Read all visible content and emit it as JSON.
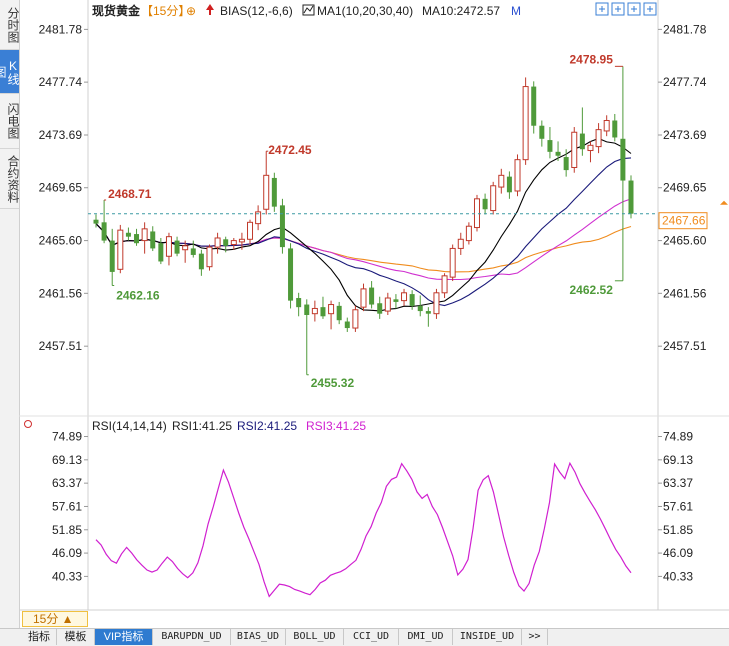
{
  "side_tabs": [
    "分时图",
    "K线图",
    "闪电图",
    "合约资料"
  ],
  "active_side_tab": 1,
  "header": {
    "symbol": "现货黄金",
    "period_tag": "【15分】",
    "bias_label": "BIAS(12,-6,6)",
    "ma_label": "MA1(10,20,30,40)",
    "ma10_value": "MA10:2472.57",
    "m_label": "M"
  },
  "rsi_header": {
    "title": "RSI(14,14,14)",
    "rsi1": "RSI1:41.25",
    "rsi2": "RSI2:41.25",
    "rsi3": "RSI3:41.25"
  },
  "period_selector": "15分 ▲",
  "bottom_tabs": [
    "指标",
    "模板",
    "VIP指标",
    "BARUPDN_UD",
    "BIAS_UD",
    "BOLL_UD",
    "CCI_UD",
    "DMI_UD",
    "INSIDE_UD",
    ">>"
  ],
  "active_bottom_tab": 2,
  "colors": {
    "up": "#c0392b",
    "down": "#4f9a3a",
    "ma_black": "#000000",
    "ma_magenta": "#d030d0",
    "ma_orange": "#f08c1e",
    "ma_navy": "#1a1a7a",
    "rsi_line": "#d020d0",
    "current_price": "#f08c1e"
  },
  "chart_data": [
    {
      "type": "candlestick",
      "title": "现货黄金 15分",
      "y_ticks": [
        2481.78,
        2477.74,
        2473.69,
        2469.65,
        2465.6,
        2461.56,
        2457.51
      ],
      "y_tick_labels": [
        "2481.78",
        "2477.74",
        "2473.69",
        "2469.65",
        "2465.60",
        "2461.56",
        "2457.51"
      ],
      "ylim": [
        2454.0,
        2482.5
      ],
      "current_price": 2467.66,
      "current_price_label": "2467.66",
      "annotations": [
        {
          "label": "2468.71",
          "candle": 1,
          "value": 2468.71
        },
        {
          "label": "2462.16",
          "candle": 2,
          "value": 2462.16
        },
        {
          "label": "2472.45",
          "candle": 21,
          "value": 2472.45
        },
        {
          "label": "2455.32",
          "candle": 26,
          "value": 2455.32
        },
        {
          "label": "2478.95",
          "candle": 65,
          "value": 2478.95
        },
        {
          "label": "2462.52",
          "candle": 65,
          "value": 2462.52
        }
      ],
      "candles": [
        {
          "o": 2467.2,
          "h": 2467.6,
          "l": 2466.6,
          "c": 2466.9
        },
        {
          "o": 2467.0,
          "h": 2468.71,
          "l": 2465.4,
          "c": 2465.6
        },
        {
          "o": 2465.6,
          "h": 2466.5,
          "l": 2462.16,
          "c": 2463.2
        },
        {
          "o": 2463.4,
          "h": 2466.8,
          "l": 2463.1,
          "c": 2466.4
        },
        {
          "o": 2466.2,
          "h": 2466.6,
          "l": 2465.6,
          "c": 2465.9
        },
        {
          "o": 2466.1,
          "h": 2466.5,
          "l": 2465.2,
          "c": 2465.4
        },
        {
          "o": 2465.6,
          "h": 2467.0,
          "l": 2464.6,
          "c": 2466.5
        },
        {
          "o": 2466.3,
          "h": 2466.7,
          "l": 2464.8,
          "c": 2465.0
        },
        {
          "o": 2465.4,
          "h": 2465.8,
          "l": 2463.8,
          "c": 2464.0
        },
        {
          "o": 2464.4,
          "h": 2466.2,
          "l": 2463.7,
          "c": 2465.9
        },
        {
          "o": 2465.6,
          "h": 2465.9,
          "l": 2464.4,
          "c": 2464.6
        },
        {
          "o": 2464.9,
          "h": 2465.6,
          "l": 2463.9,
          "c": 2465.2
        },
        {
          "o": 2465.0,
          "h": 2465.6,
          "l": 2464.3,
          "c": 2464.5
        },
        {
          "o": 2464.6,
          "h": 2464.9,
          "l": 2462.9,
          "c": 2463.4
        },
        {
          "o": 2463.6,
          "h": 2465.3,
          "l": 2463.3,
          "c": 2465.1
        },
        {
          "o": 2465.1,
          "h": 2466.2,
          "l": 2464.6,
          "c": 2465.8
        },
        {
          "o": 2465.7,
          "h": 2465.9,
          "l": 2464.7,
          "c": 2465.2
        },
        {
          "o": 2465.3,
          "h": 2465.8,
          "l": 2464.9,
          "c": 2465.6
        },
        {
          "o": 2465.5,
          "h": 2466.2,
          "l": 2464.9,
          "c": 2465.7
        },
        {
          "o": 2465.7,
          "h": 2467.2,
          "l": 2465.3,
          "c": 2467.0
        },
        {
          "o": 2466.9,
          "h": 2468.3,
          "l": 2466.4,
          "c": 2467.8
        },
        {
          "o": 2468.0,
          "h": 2472.45,
          "l": 2467.6,
          "c": 2470.6
        },
        {
          "o": 2470.4,
          "h": 2470.8,
          "l": 2467.8,
          "c": 2468.2
        },
        {
          "o": 2468.3,
          "h": 2468.8,
          "l": 2464.6,
          "c": 2465.1
        },
        {
          "o": 2465.0,
          "h": 2465.4,
          "l": 2460.4,
          "c": 2461.0
        },
        {
          "o": 2461.2,
          "h": 2461.6,
          "l": 2459.8,
          "c": 2460.5
        },
        {
          "o": 2460.7,
          "h": 2461.1,
          "l": 2455.32,
          "c": 2459.9
        },
        {
          "o": 2460.0,
          "h": 2461.0,
          "l": 2459.4,
          "c": 2460.4
        },
        {
          "o": 2460.5,
          "h": 2461.3,
          "l": 2459.6,
          "c": 2459.8
        },
        {
          "o": 2460.0,
          "h": 2461.0,
          "l": 2458.8,
          "c": 2460.7
        },
        {
          "o": 2460.6,
          "h": 2460.9,
          "l": 2459.2,
          "c": 2459.5
        },
        {
          "o": 2459.4,
          "h": 2459.7,
          "l": 2458.6,
          "c": 2458.9
        },
        {
          "o": 2458.9,
          "h": 2460.6,
          "l": 2458.6,
          "c": 2460.3
        },
        {
          "o": 2460.5,
          "h": 2462.3,
          "l": 2460.2,
          "c": 2461.9
        },
        {
          "o": 2462.0,
          "h": 2462.5,
          "l": 2460.4,
          "c": 2460.7
        },
        {
          "o": 2460.8,
          "h": 2461.3,
          "l": 2459.6,
          "c": 2460.0
        },
        {
          "o": 2460.2,
          "h": 2461.6,
          "l": 2459.9,
          "c": 2461.2
        },
        {
          "o": 2461.1,
          "h": 2461.5,
          "l": 2460.4,
          "c": 2460.9
        },
        {
          "o": 2461.0,
          "h": 2461.9,
          "l": 2460.6,
          "c": 2461.6
        },
        {
          "o": 2461.5,
          "h": 2461.8,
          "l": 2460.3,
          "c": 2460.6
        },
        {
          "o": 2460.6,
          "h": 2461.4,
          "l": 2459.8,
          "c": 2460.2
        },
        {
          "o": 2460.2,
          "h": 2460.5,
          "l": 2459.0,
          "c": 2460.0
        },
        {
          "o": 2460.0,
          "h": 2461.9,
          "l": 2459.6,
          "c": 2461.6
        },
        {
          "o": 2461.6,
          "h": 2463.1,
          "l": 2461.2,
          "c": 2462.9
        },
        {
          "o": 2462.8,
          "h": 2465.3,
          "l": 2462.5,
          "c": 2465.0
        },
        {
          "o": 2465.0,
          "h": 2466.2,
          "l": 2464.5,
          "c": 2465.7
        },
        {
          "o": 2465.6,
          "h": 2467.0,
          "l": 2465.3,
          "c": 2466.7
        },
        {
          "o": 2466.6,
          "h": 2469.1,
          "l": 2466.3,
          "c": 2468.8
        },
        {
          "o": 2468.8,
          "h": 2469.2,
          "l": 2467.6,
          "c": 2468.0
        },
        {
          "o": 2467.9,
          "h": 2470.1,
          "l": 2467.6,
          "c": 2469.8
        },
        {
          "o": 2469.7,
          "h": 2471.1,
          "l": 2469.2,
          "c": 2470.6
        },
        {
          "o": 2470.5,
          "h": 2470.9,
          "l": 2468.8,
          "c": 2469.3
        },
        {
          "o": 2469.4,
          "h": 2472.2,
          "l": 2469.0,
          "c": 2471.8
        },
        {
          "o": 2471.8,
          "h": 2478.1,
          "l": 2471.4,
          "c": 2477.4
        },
        {
          "o": 2477.4,
          "h": 2477.8,
          "l": 2473.8,
          "c": 2474.4
        },
        {
          "o": 2474.4,
          "h": 2474.8,
          "l": 2472.8,
          "c": 2473.4
        },
        {
          "o": 2473.3,
          "h": 2474.3,
          "l": 2471.9,
          "c": 2472.4
        },
        {
          "o": 2472.4,
          "h": 2473.2,
          "l": 2471.7,
          "c": 2472.1
        },
        {
          "o": 2472.0,
          "h": 2472.6,
          "l": 2470.5,
          "c": 2471.0
        },
        {
          "o": 2471.2,
          "h": 2474.3,
          "l": 2470.8,
          "c": 2473.9
        },
        {
          "o": 2473.8,
          "h": 2475.8,
          "l": 2472.1,
          "c": 2472.6
        },
        {
          "o": 2472.5,
          "h": 2473.2,
          "l": 2471.6,
          "c": 2472.9
        },
        {
          "o": 2472.8,
          "h": 2474.6,
          "l": 2472.3,
          "c": 2474.1
        },
        {
          "o": 2474.0,
          "h": 2475.2,
          "l": 2473.6,
          "c": 2474.8
        },
        {
          "o": 2474.8,
          "h": 2475.3,
          "l": 2473.2,
          "c": 2473.5
        },
        {
          "o": 2473.4,
          "h": 2478.95,
          "l": 2462.52,
          "c": 2470.2
        },
        {
          "o": 2470.2,
          "h": 2470.6,
          "l": 2467.3,
          "c": 2467.66
        }
      ]
    },
    {
      "type": "line",
      "title": "RSI(14,14,14)",
      "y_ticks": [
        74.89,
        69.13,
        63.37,
        57.61,
        51.85,
        46.09,
        40.33
      ],
      "y_tick_labels": [
        "74.89",
        "69.13",
        "63.37",
        "57.61",
        "51.85",
        "46.09",
        "40.33"
      ],
      "ylim": [
        34.5,
        76.5
      ],
      "series": [
        {
          "name": "RSI3",
          "values": [
            49.4,
            48.1,
            45.8,
            44.2,
            43.6,
            45.9,
            47.5,
            46.1,
            44.4,
            43.1,
            41.9,
            41.4,
            41.9,
            43.6,
            45.1,
            44.0,
            42.3,
            41.0,
            40.0,
            41.2,
            43.7,
            47.9,
            53.3,
            57.5,
            62.1,
            66.6,
            63.6,
            59.8,
            56.0,
            52.5,
            49.6,
            46.4,
            43.3,
            39.0,
            35.4,
            36.9,
            38.4,
            38.2,
            37.8,
            37.1,
            36.7,
            36.2,
            35.8,
            37.1,
            38.7,
            39.4,
            40.6,
            41.1,
            41.5,
            42.2,
            43.3,
            44.3,
            47.0,
            50.3,
            52.6,
            56.0,
            58.6,
            62.6,
            64.3,
            64.9,
            68.2,
            66.4,
            64.3,
            61.2,
            59.6,
            60.6,
            57.6,
            55.6,
            52.4,
            48.9,
            45.4,
            40.7,
            42.1,
            44.5,
            52.1,
            61.6,
            64.2,
            65.2,
            61.2,
            55.7,
            50.1,
            45.5,
            41.3,
            38.0,
            36.7,
            38.6,
            43.1,
            46.5,
            52.2,
            58.6,
            68.1,
            66.1,
            64.5,
            68.3,
            66.1,
            63.2,
            60.9,
            58.8,
            56.8,
            54.5,
            52.0,
            49.4,
            47.0,
            45.1,
            42.9,
            41.25
          ]
        }
      ]
    }
  ]
}
